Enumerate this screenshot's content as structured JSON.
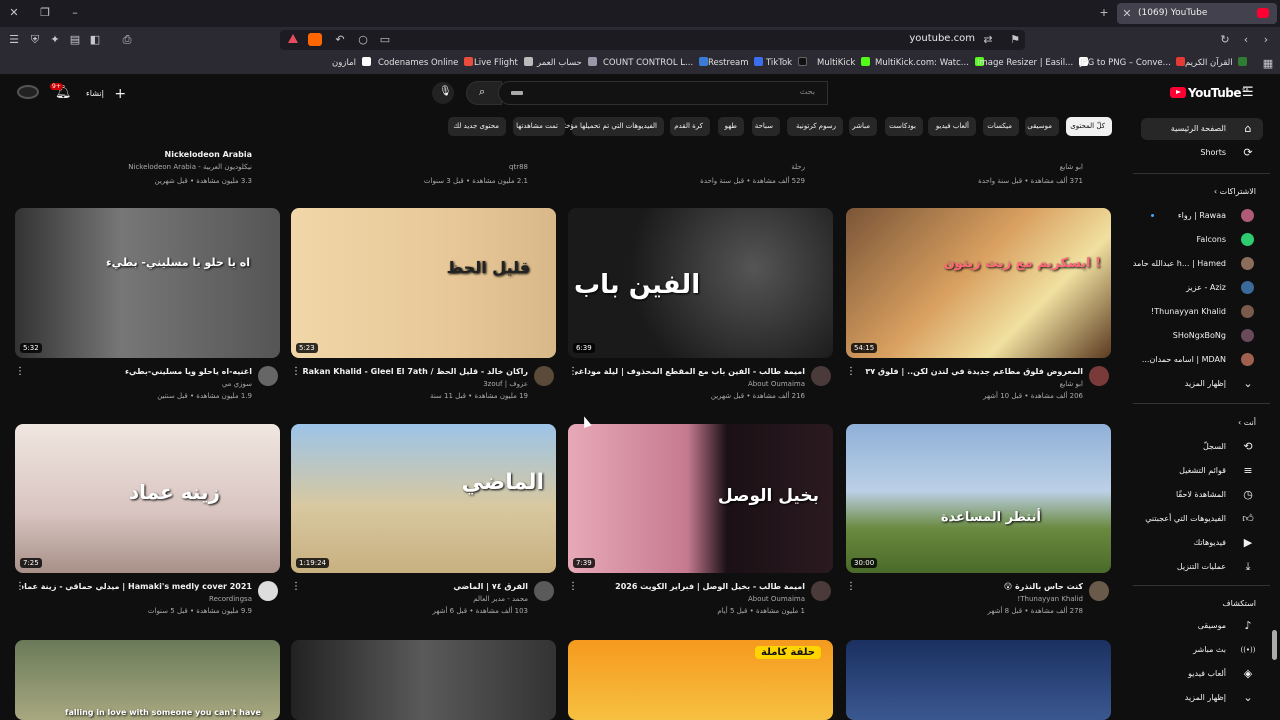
{
  "browser": {
    "tab_title": "(1069) YouTube",
    "url": "youtube.com",
    "bookmarks": [
      {
        "label": "امازون",
        "color": "#ffffff"
      },
      {
        "label": "Codenames Online",
        "color": "#e94b3c"
      },
      {
        "label": "Live Flight",
        "color": "#bbbbbb"
      },
      {
        "label": "حساب العمر",
        "color": "#9999aa"
      },
      {
        "label": "COUNT CONTROL L...",
        "color": "#3a7bd5"
      },
      {
        "label": "Restream",
        "color": "#3c6ff0"
      },
      {
        "label": "TikTok",
        "color": "#111111"
      },
      {
        "label": "MultiKick",
        "color": "#53fc18"
      },
      {
        "label": "MultiKick.com: Watc...",
        "color": "#53fc18"
      },
      {
        "label": "Image Resizer | Easil...",
        "color": "#ffffff"
      },
      {
        "label": "JPG to PNG – Conve...",
        "color": "#e53935"
      },
      {
        "label": "القرآن الكريم",
        "color": "#2e7d32"
      }
    ]
  },
  "header": {
    "logo": "YouTube",
    "logo_region": "SA",
    "search_placeholder": "بحث",
    "create_label": "إنشاء",
    "notif_count": "9+"
  },
  "chips": [
    "كلّ المحتوى",
    "موسيقى",
    "ميكسات",
    "ألعاب فيديو",
    "بودكاست",
    "مباشر",
    "رسوم كرتونية",
    "سباحة",
    "طهو",
    "كرة القدم",
    "الفيديوهات التي تم تحميلها مؤخرًا",
    "تمت مشاهدتها",
    "محتوى جديد لك"
  ],
  "sidebar": {
    "home": "الصفحة الرئيسية",
    "shorts": "Shorts",
    "subs_header": "الاشتراكات",
    "subs": [
      "Rawaa | رواء",
      "Falcons",
      "h... | Hamed عبدالله حامد",
      "Aziz - عزيز",
      "Thunayyan Khalid!",
      "SHoNgxBoNg",
      "MDAN | اسامه حمدان..."
    ],
    "show_more": "إظهار المزيد",
    "you_header": "أنت",
    "you_items": [
      "السجلّ",
      "قوائم التشغيل",
      "المشاهدة لاحقًا",
      "الفيديوهات التي أعجبتني",
      "فيديوهاتك",
      "عمليات التنزيل"
    ],
    "explore_header": "استكشاف",
    "explore_items": [
      "موسيقى",
      "بث مباشر",
      "ألعاب فيديو",
      "إظهار المزيد"
    ]
  },
  "top_partial": [
    {
      "channel": "ابو شايع",
      "meta": "371 ألف مشاهدة • قبل سنة واحدة"
    },
    {
      "channel": "رحلة",
      "meta": "529 ألف مشاهدة • قبل سنة واحدة"
    },
    {
      "channel": "qtr88",
      "meta": "2.1 مليون مشاهدة • قبل 3 سنوات"
    },
    {
      "title": "Nickelodeon Arabia",
      "channel": "نيكلوديون العربية - Nickelodeon Arabia",
      "meta": "3.3 مليون مشاهدة • قبل شهرين"
    }
  ],
  "row1": [
    {
      "title": "المعروض فلوق مطاعم جديدة في لندن لكن.. | فلوق ٣٧",
      "channel": "ابو شايع",
      "meta": "206 ألف مشاهدة • قبل 10 أشهر",
      "duration": "54:15",
      "overlay": "ايسكريم مع زيت زيتون !"
    },
    {
      "title": "اميمة طالب - الفين باب مع المقطع المحذوف | ليلة موداغي 2026",
      "channel": "About Oumaima",
      "meta": "216 ألف مشاهدة • قبل شهرين",
      "duration": "6:39",
      "overlay": "الفين باب"
    },
    {
      "title": "راكان خالد - قليل الحظ / Rakan Khalid - Gleel El 7ath",
      "channel": "عزوف | 3zouf",
      "meta": "19 مليون مشاهدة • قبل 11 سنة",
      "duration": "5:23",
      "overlay": "قليل الحظ"
    },
    {
      "title": "اغنيه-اه ياحلو ويا مسليني-بطيء",
      "channel": "سوزي مي",
      "meta": "1.9 مليون مشاهدة • قبل سنتين",
      "duration": "5:32",
      "overlay": "اه يا حلو يا مسليني- بطيء"
    }
  ],
  "row2": [
    {
      "title": "كنت حاس بالنذرة 😮",
      "channel": "Thunayyan Khalid!",
      "meta": "278 ألف مشاهدة • قبل 8 أشهر",
      "duration": "30:00",
      "overlay": "أنتظر المساعدة"
    },
    {
      "title": "اميمة طالب - بخيل الوصل | فبراير الكويت 2026",
      "channel": "About Oumaima",
      "meta": "1 مليون مشاهدة • قبل 5 أيام",
      "duration": "7:39",
      "overlay": "بخيل الوصل"
    },
    {
      "title": "الفرق ٧٤ | الماضي",
      "channel": "محمد - مدير العالم",
      "meta": "103 ألف مشاهدة • قبل 6 أشهر",
      "duration": "1:19:24",
      "overlay": "الماضي"
    },
    {
      "title": "Hamaki's medly cover 2021 | ميدلي حماقي - زينة عماد",
      "channel": "Recordingsa",
      "meta": "9.9 مليون مشاهدة • قبل 5 سنوات",
      "duration": "7:25",
      "overlay": "زينه عماد"
    }
  ],
  "row3": [
    {
      "overlay": ""
    },
    {
      "overlay": "حلقة كاملة"
    },
    {
      "overlay": ""
    },
    {
      "overlay": "falling in love with someone you can't have"
    }
  ]
}
